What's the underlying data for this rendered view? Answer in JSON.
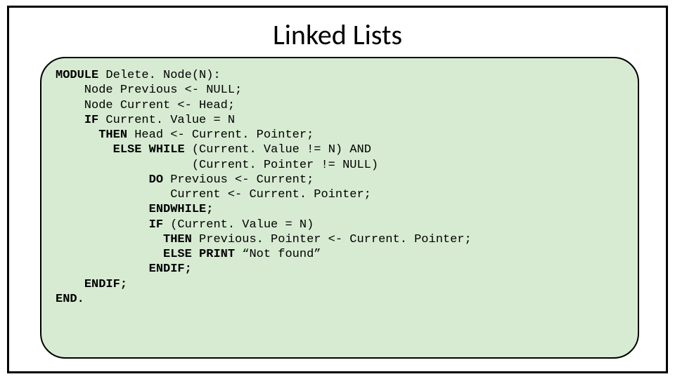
{
  "title": "Linked Lists",
  "code": {
    "kw_module": "MODULE",
    "l1_rest": " Delete. Node(N):",
    "l2": "    Node Previous <- NULL;",
    "l3": "    Node Current <- Head;",
    "l4_indent": "    ",
    "kw_if": "IF",
    "l4_rest": " Current. Value = N",
    "l5_indent": "      ",
    "kw_then1": "THEN",
    "l5_rest": " Head <- Current. Pointer;",
    "l6_indent": "        ",
    "kw_else1": "ELSE",
    "l6_sp": " ",
    "kw_while": "WHILE",
    "l6_rest": " (Current. Value != N) AND",
    "l7": "                   (Current. Pointer != NULL)",
    "l8_indent": "             ",
    "kw_do": "DO",
    "l8_rest": " Previous <- Current;",
    "l9": "                Current <- Current. Pointer;",
    "l10_indent": "             ",
    "kw_endwhile": "ENDWHILE;",
    "l11_indent": "             ",
    "kw_if2": "IF",
    "l11_rest": " (Current. Value = N)",
    "l12_indent": "               ",
    "kw_then2": "THEN",
    "l12_rest": " Previous. Pointer <- Current. Pointer;",
    "l13_indent": "               ",
    "kw_else2": "ELSE",
    "l13_sp": " ",
    "kw_print": "PRINT",
    "l13_rest": " “Not found”",
    "l14_indent": "             ",
    "kw_endif1": "ENDIF;",
    "l15_indent": "    ",
    "kw_endif2": "ENDIF;",
    "kw_end": "END."
  }
}
